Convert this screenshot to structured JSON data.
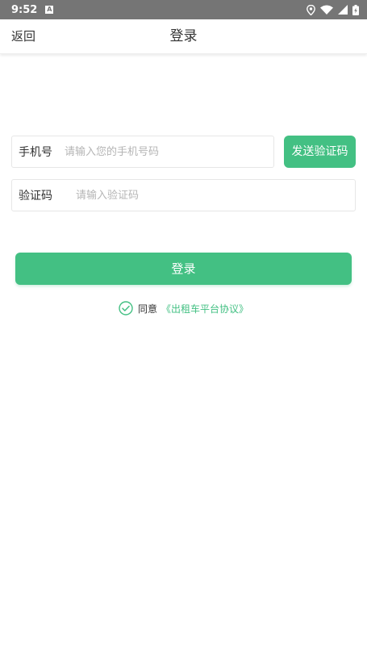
{
  "status_bar": {
    "time": "9:52",
    "app_icon_letter": "A"
  },
  "nav": {
    "back_label": "返回",
    "title": "登录"
  },
  "form": {
    "phone_label": "手机号",
    "phone_placeholder": "请输入您的手机号码",
    "phone_value": "",
    "send_code_label": "发送验证码",
    "code_label": "验证码",
    "code_placeholder": "请输入验证码",
    "code_value": "",
    "login_label": "登录"
  },
  "agreement": {
    "checked": true,
    "text": "同意",
    "link_text": "《出租车平台协议》"
  },
  "colors": {
    "accent": "#43c083",
    "status_bar": "#757575",
    "text": "#333333",
    "placeholder": "#b5b5b5"
  },
  "icons": [
    "location-icon",
    "wifi-icon",
    "signal-icon",
    "battery-icon",
    "check-circle-icon"
  ]
}
